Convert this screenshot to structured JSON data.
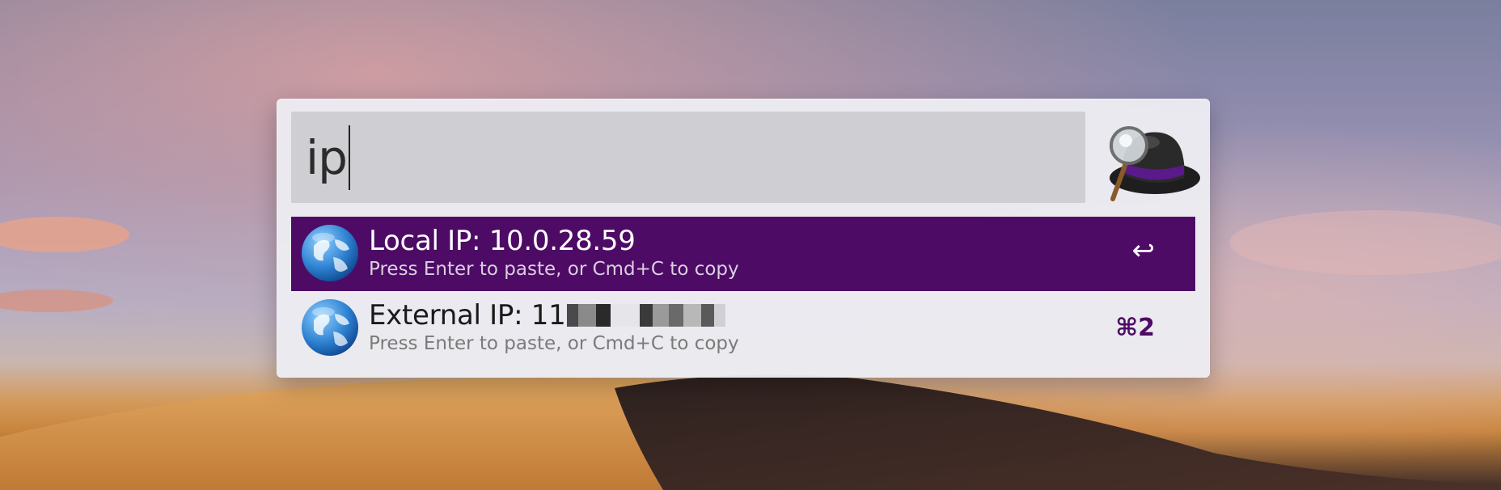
{
  "search": {
    "query": "ip"
  },
  "results": [
    {
      "title": "Local IP: 10.0.28.59",
      "subtitle": "Press Enter to paste, or Cmd+C to copy",
      "shortcut": "↩",
      "selected": true
    },
    {
      "title": "External IP: 11",
      "subtitle": "Press Enter to paste, or Cmd+C to copy",
      "shortcut": "⌘2",
      "selected": false
    }
  ],
  "icons": {
    "logo": "alfred-hat-icon",
    "result": "globe-icon",
    "enter": "return-key-icon"
  },
  "colors": {
    "selection": "#4d0b65",
    "panel": "#ececf1",
    "search_field": "#cfcfd3"
  }
}
